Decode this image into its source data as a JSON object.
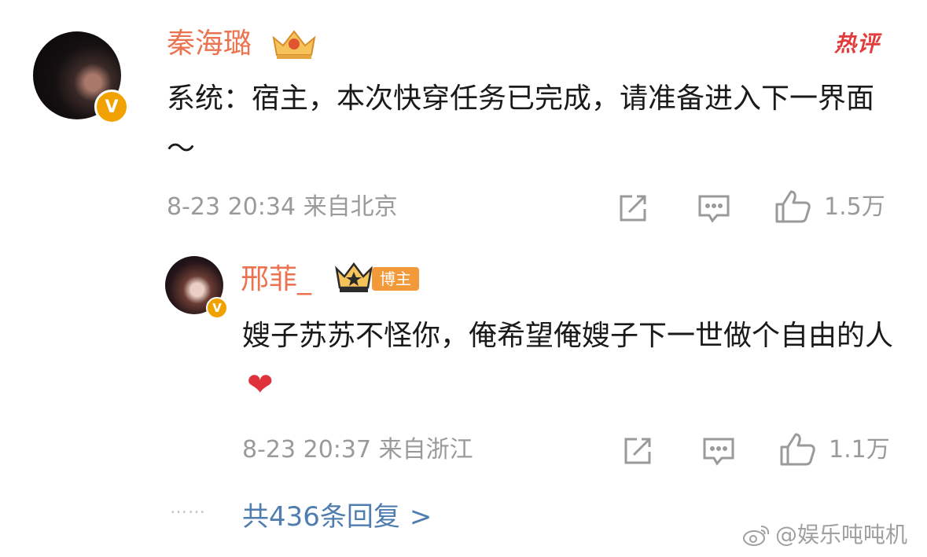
{
  "comment": {
    "username": "秦海璐",
    "hot_label": "热评",
    "text": "系统：宿主，本次快穿任务已完成，请准备进入下一界面～",
    "meta": "8-23 20:34 来自北京",
    "likes": "1.5万",
    "verified_badge": "V",
    "icons": [
      "crown-icon",
      "share-icon",
      "comment-icon",
      "like-icon"
    ]
  },
  "reply": {
    "username": "邢菲_",
    "badge": "博主",
    "text": "嫂子苏苏不怪你，俺希望俺嫂子下一世做个自由的人",
    "emoji": "❤",
    "meta": "8-23 20:37 来自浙江",
    "likes": "1.1万",
    "verified_badge": "V"
  },
  "footer": {
    "dots": "……",
    "replies_label": "共436条回复",
    "replies_chevron": ">",
    "watermark": "@娱乐吨吨机"
  },
  "colors": {
    "username": "#eb7350",
    "link": "#507daf",
    "meta": "#9a9a9a",
    "verified": "#f2a200",
    "hot": "#e23d3d"
  }
}
